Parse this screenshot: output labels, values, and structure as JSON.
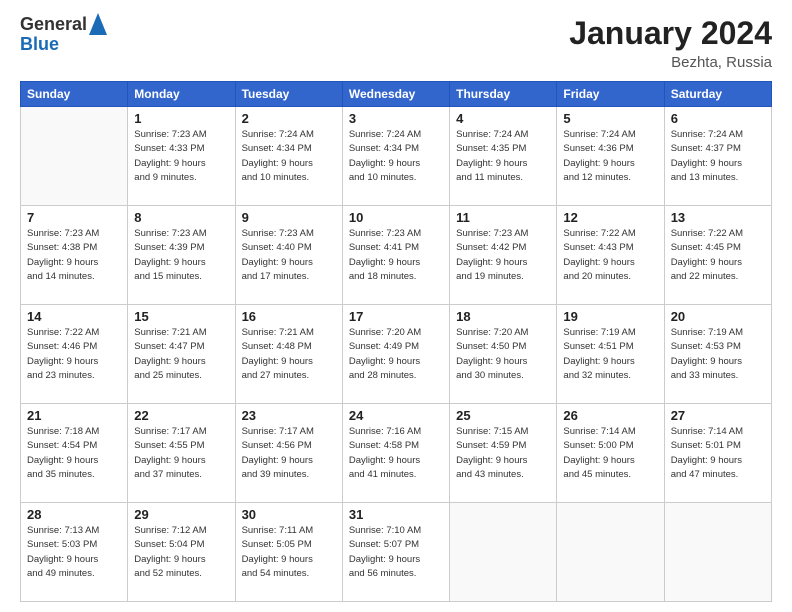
{
  "header": {
    "logo_general": "General",
    "logo_blue": "Blue",
    "month_title": "January 2024",
    "location": "Bezhta, Russia"
  },
  "weekdays": [
    "Sunday",
    "Monday",
    "Tuesday",
    "Wednesday",
    "Thursday",
    "Friday",
    "Saturday"
  ],
  "weeks": [
    [
      {
        "day": "",
        "info": ""
      },
      {
        "day": "1",
        "info": "Sunrise: 7:23 AM\nSunset: 4:33 PM\nDaylight: 9 hours\nand 9 minutes."
      },
      {
        "day": "2",
        "info": "Sunrise: 7:24 AM\nSunset: 4:34 PM\nDaylight: 9 hours\nand 10 minutes."
      },
      {
        "day": "3",
        "info": "Sunrise: 7:24 AM\nSunset: 4:34 PM\nDaylight: 9 hours\nand 10 minutes."
      },
      {
        "day": "4",
        "info": "Sunrise: 7:24 AM\nSunset: 4:35 PM\nDaylight: 9 hours\nand 11 minutes."
      },
      {
        "day": "5",
        "info": "Sunrise: 7:24 AM\nSunset: 4:36 PM\nDaylight: 9 hours\nand 12 minutes."
      },
      {
        "day": "6",
        "info": "Sunrise: 7:24 AM\nSunset: 4:37 PM\nDaylight: 9 hours\nand 13 minutes."
      }
    ],
    [
      {
        "day": "7",
        "info": "Sunrise: 7:23 AM\nSunset: 4:38 PM\nDaylight: 9 hours\nand 14 minutes."
      },
      {
        "day": "8",
        "info": "Sunrise: 7:23 AM\nSunset: 4:39 PM\nDaylight: 9 hours\nand 15 minutes."
      },
      {
        "day": "9",
        "info": "Sunrise: 7:23 AM\nSunset: 4:40 PM\nDaylight: 9 hours\nand 17 minutes."
      },
      {
        "day": "10",
        "info": "Sunrise: 7:23 AM\nSunset: 4:41 PM\nDaylight: 9 hours\nand 18 minutes."
      },
      {
        "day": "11",
        "info": "Sunrise: 7:23 AM\nSunset: 4:42 PM\nDaylight: 9 hours\nand 19 minutes."
      },
      {
        "day": "12",
        "info": "Sunrise: 7:22 AM\nSunset: 4:43 PM\nDaylight: 9 hours\nand 20 minutes."
      },
      {
        "day": "13",
        "info": "Sunrise: 7:22 AM\nSunset: 4:45 PM\nDaylight: 9 hours\nand 22 minutes."
      }
    ],
    [
      {
        "day": "14",
        "info": "Sunrise: 7:22 AM\nSunset: 4:46 PM\nDaylight: 9 hours\nand 23 minutes."
      },
      {
        "day": "15",
        "info": "Sunrise: 7:21 AM\nSunset: 4:47 PM\nDaylight: 9 hours\nand 25 minutes."
      },
      {
        "day": "16",
        "info": "Sunrise: 7:21 AM\nSunset: 4:48 PM\nDaylight: 9 hours\nand 27 minutes."
      },
      {
        "day": "17",
        "info": "Sunrise: 7:20 AM\nSunset: 4:49 PM\nDaylight: 9 hours\nand 28 minutes."
      },
      {
        "day": "18",
        "info": "Sunrise: 7:20 AM\nSunset: 4:50 PM\nDaylight: 9 hours\nand 30 minutes."
      },
      {
        "day": "19",
        "info": "Sunrise: 7:19 AM\nSunset: 4:51 PM\nDaylight: 9 hours\nand 32 minutes."
      },
      {
        "day": "20",
        "info": "Sunrise: 7:19 AM\nSunset: 4:53 PM\nDaylight: 9 hours\nand 33 minutes."
      }
    ],
    [
      {
        "day": "21",
        "info": "Sunrise: 7:18 AM\nSunset: 4:54 PM\nDaylight: 9 hours\nand 35 minutes."
      },
      {
        "day": "22",
        "info": "Sunrise: 7:17 AM\nSunset: 4:55 PM\nDaylight: 9 hours\nand 37 minutes."
      },
      {
        "day": "23",
        "info": "Sunrise: 7:17 AM\nSunset: 4:56 PM\nDaylight: 9 hours\nand 39 minutes."
      },
      {
        "day": "24",
        "info": "Sunrise: 7:16 AM\nSunset: 4:58 PM\nDaylight: 9 hours\nand 41 minutes."
      },
      {
        "day": "25",
        "info": "Sunrise: 7:15 AM\nSunset: 4:59 PM\nDaylight: 9 hours\nand 43 minutes."
      },
      {
        "day": "26",
        "info": "Sunrise: 7:14 AM\nSunset: 5:00 PM\nDaylight: 9 hours\nand 45 minutes."
      },
      {
        "day": "27",
        "info": "Sunrise: 7:14 AM\nSunset: 5:01 PM\nDaylight: 9 hours\nand 47 minutes."
      }
    ],
    [
      {
        "day": "28",
        "info": "Sunrise: 7:13 AM\nSunset: 5:03 PM\nDaylight: 9 hours\nand 49 minutes."
      },
      {
        "day": "29",
        "info": "Sunrise: 7:12 AM\nSunset: 5:04 PM\nDaylight: 9 hours\nand 52 minutes."
      },
      {
        "day": "30",
        "info": "Sunrise: 7:11 AM\nSunset: 5:05 PM\nDaylight: 9 hours\nand 54 minutes."
      },
      {
        "day": "31",
        "info": "Sunrise: 7:10 AM\nSunset: 5:07 PM\nDaylight: 9 hours\nand 56 minutes."
      },
      {
        "day": "",
        "info": ""
      },
      {
        "day": "",
        "info": ""
      },
      {
        "day": "",
        "info": ""
      }
    ]
  ]
}
